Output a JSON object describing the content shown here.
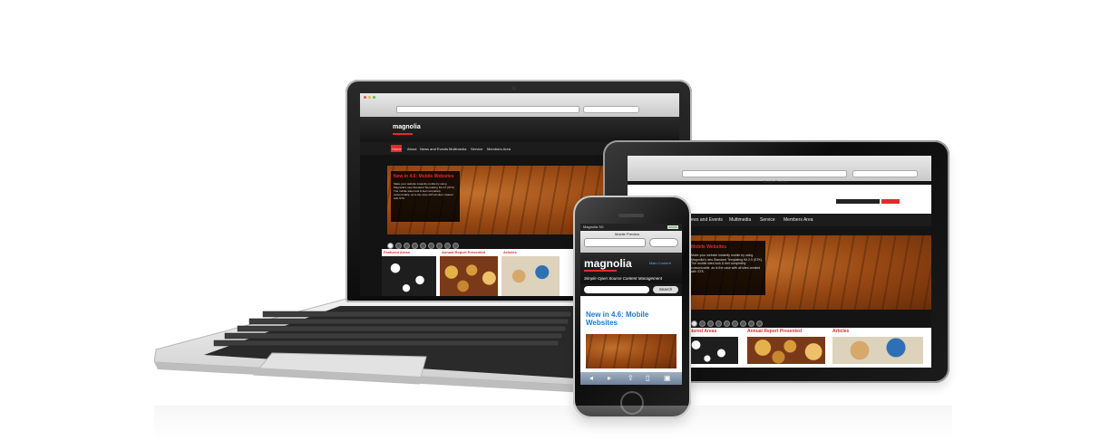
{
  "laptop_site": {
    "logo": "magnolia",
    "nav": [
      "Home",
      "About",
      "News and Events",
      "Multimedia",
      "Service",
      "Members Area"
    ],
    "hero_title": "New in 4.6: Mobile Websites",
    "hero_body": "Make your website instantly mobile by using Magnolia's new Standard Templating Kit 2.0 (STK). The mobile sites look & feel completely customizable, as is the case with all sites created with STK.",
    "sections": [
      "Featured Areas",
      "Annual Report Presented",
      "Articles"
    ]
  },
  "tablet_site": {
    "page_title": "Mobile Preview",
    "nav": [
      "News and Events",
      "Multimedia",
      "Service",
      "Members Area"
    ],
    "hero_title": "Mobile Websites",
    "hero_body": "Make your website instantly mobile by using Magnolia's new Standard Templating Kit 2.0 (STK). The mobile sites look & feel completely customizable, as is the case with all sites created with STK.",
    "sections": [
      "Featured Areas",
      "Annual Report Presented",
      "Articles"
    ]
  },
  "phone_site": {
    "carrier": "Magnolia 3G",
    "tab_label": "Mobile Preview",
    "logo": "magnolia",
    "nav_link": "Main Content",
    "tagline": "Simple Open Source Content Management",
    "search_button": "Search",
    "headline": "New in 4.6: Mobile Websites"
  },
  "colors": {
    "accent_red": "#e32a2a",
    "phone_headline_blue": "#1a7ad6",
    "wood": "#9a4a14",
    "device_black": "#111111"
  }
}
